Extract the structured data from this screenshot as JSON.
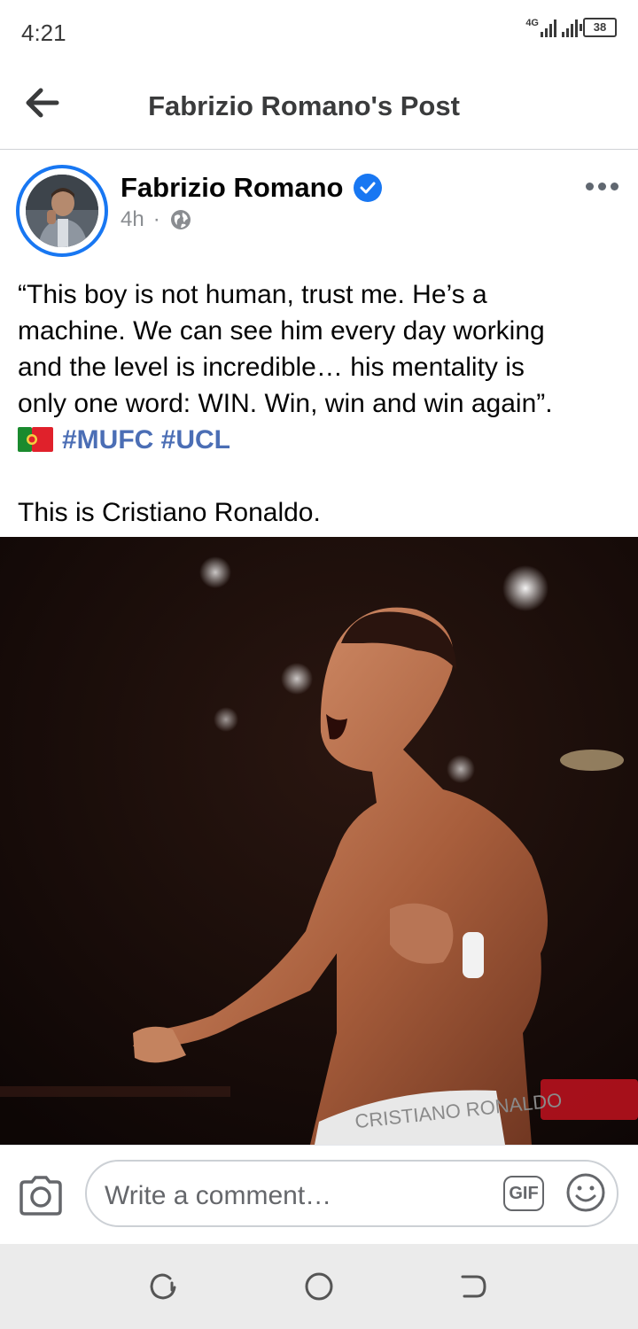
{
  "status_bar": {
    "time": "4:21",
    "network": "4G",
    "battery": "38"
  },
  "header": {
    "title": "Fabrizio Romano's Post"
  },
  "post": {
    "author": "Fabrizio Romano",
    "time": "4h",
    "separator": "·",
    "lines": [
      "“This boy is not human, trust me. He’s a",
      "machine. We can see him every day working",
      "and the level is incredible… his mentality is",
      "only one word: WIN. Win, win and win again”."
    ],
    "hashtags": "#MUFC #UCL",
    "closing": "This is Cristiano Ronaldo.",
    "flag": "portugal-flag",
    "photo_caption_text": "CRISTIANO RONALDO"
  },
  "comment": {
    "placeholder": "Write a comment…",
    "gif_label": "GIF"
  },
  "colors": {
    "brand_blue": "#1877f2",
    "hashtag": "#4b6eb5",
    "secondary_text": "#8a8d91"
  }
}
